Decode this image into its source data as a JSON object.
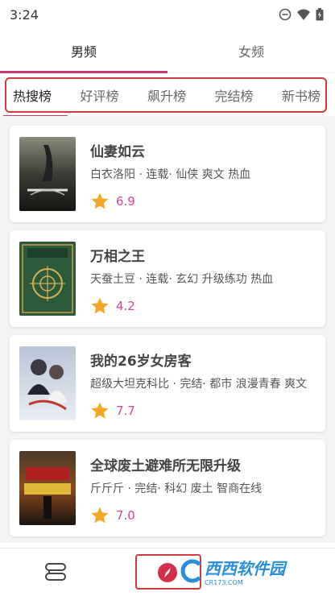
{
  "status": {
    "time": "3:24"
  },
  "gender_tabs": [
    {
      "label": "男频",
      "active": true
    },
    {
      "label": "女频",
      "active": false
    }
  ],
  "rank_tabs": [
    {
      "label": "热搜榜",
      "active": true
    },
    {
      "label": "好评榜",
      "active": false
    },
    {
      "label": "飙升榜",
      "active": false
    },
    {
      "label": "完结榜",
      "active": false
    },
    {
      "label": "新书榜",
      "active": false
    }
  ],
  "books": [
    {
      "title": "仙妻如云",
      "meta": "白衣洛阳 · 连载· 仙侠 爽文 热血",
      "score": "6.9"
    },
    {
      "title": "万相之王",
      "meta": "天蚕土豆 · 连载· 玄幻 升级练功 热血",
      "score": "4.2"
    },
    {
      "title": "我的26岁女房客",
      "meta": "超级大坦克科比 · 完结· 都市 浪漫青春 爽文",
      "score": "7.7"
    },
    {
      "title": "全球废土避难所无限升级",
      "meta": "斤斤斤 · 完结· 科幻 废土 智商在线",
      "score": "7.0"
    }
  ],
  "colors": {
    "accent": "#c13a70",
    "score": "#d0479a",
    "star": "#f5a623",
    "highlight_box": "#d33a3a"
  },
  "watermark": {
    "brand": "西西软件园",
    "url": "CR173.COM"
  },
  "icons": {
    "nav_left": "bookshelf-icon",
    "nav_center": "discover-icon"
  }
}
